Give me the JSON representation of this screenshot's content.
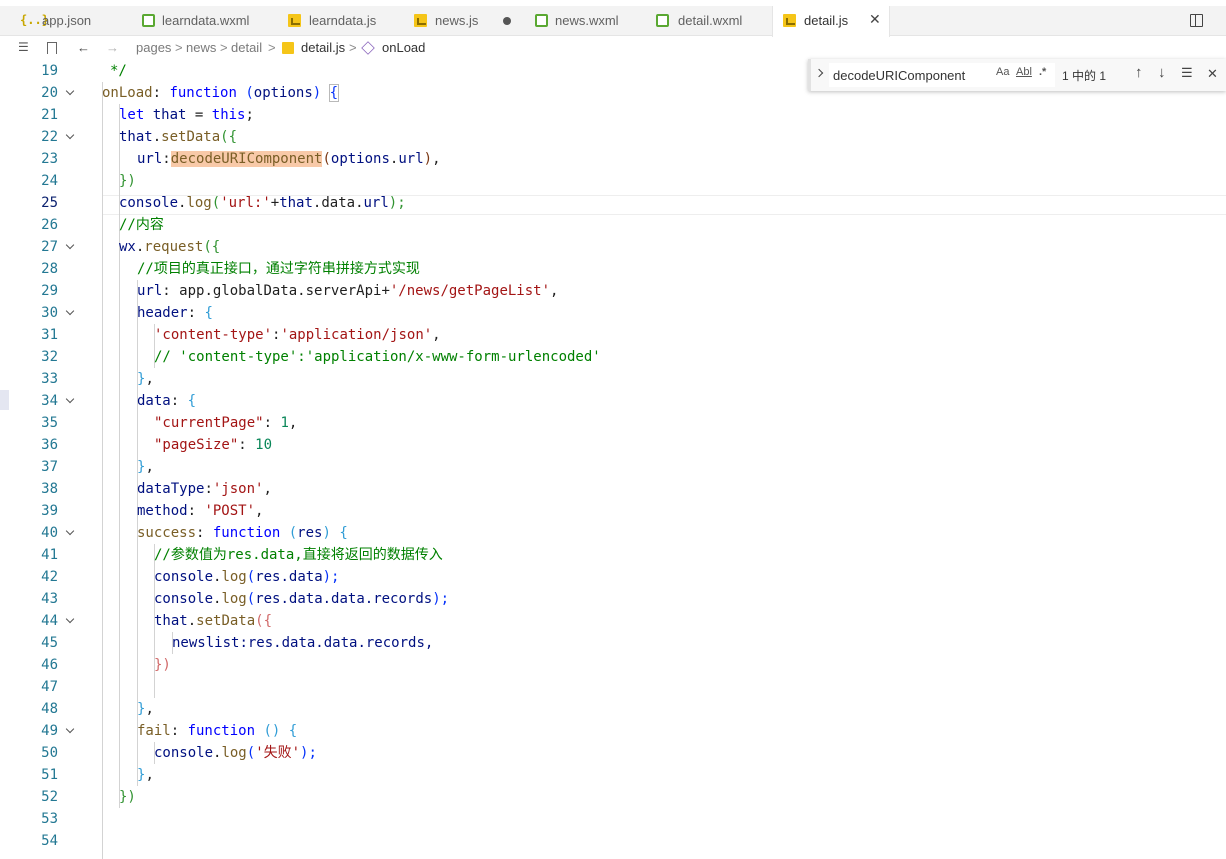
{
  "tabs": [
    {
      "label": "app.json",
      "icon": "json-file-icon"
    },
    {
      "label": "learndata.wxml",
      "icon": "wxml-file-icon"
    },
    {
      "label": "learndata.js",
      "icon": "js-file-icon"
    },
    {
      "label": "news.js",
      "icon": "js-file-icon",
      "modified": true
    },
    {
      "label": "news.wxml",
      "icon": "wxml-file-icon"
    },
    {
      "label": "detail.wxml",
      "icon": "wxml-file-icon"
    },
    {
      "label": "detail.js",
      "icon": "js-file-icon",
      "active": true
    }
  ],
  "tab_icons": {
    "json": "{..}",
    "close": "✕"
  },
  "breadcrumb": {
    "parts": [
      "pages",
      "news",
      "detail",
      "detail.js",
      "onLoad"
    ],
    "separator": ">"
  },
  "find": {
    "query": "decodeURIComponent",
    "match_case": "Aa",
    "whole_word": "Abl",
    "regex": ".*",
    "result": "1 中的 1",
    "prev": "↑",
    "next": "↓",
    "in_selection": "☰",
    "close": "✕"
  },
  "nav": {
    "back": "←",
    "forward": "→",
    "list": "☰",
    "bookmark": "🔖"
  },
  "editor": {
    "current_line": "25",
    "line_numbers": [
      "19",
      "20",
      "21",
      "22",
      "23",
      "24",
      "25",
      "26",
      "27",
      "28",
      "29",
      "30",
      "31",
      "32",
      "33",
      "34",
      "35",
      "36",
      "37",
      "38",
      "39",
      "40",
      "41",
      "42",
      "43",
      "44",
      "45",
      "46",
      "47",
      "48",
      "49",
      "50",
      "51",
      "52",
      "53",
      "54"
    ],
    "fold_lines": [
      "20",
      "22",
      "27",
      "30",
      "34",
      "40",
      "44",
      "49"
    ]
  },
  "code": {
    "l19": "*/",
    "l20": {
      "a": "onLoad",
      "b": ":",
      "c": "function",
      "d": "(",
      "e": "options",
      "f": ")",
      "g": "{"
    },
    "l21": {
      "a": "let",
      "b": "that",
      "c": "=",
      "d": "this",
      "e": ";"
    },
    "l22": {
      "a": "that",
      "b": ".",
      "c": "setData",
      "d": "({"
    },
    "l23": {
      "a": "url",
      "b": ":",
      "c": "decodeURIComponent",
      "d": "(",
      "e": "options",
      "f": ".",
      "g": "url",
      "h": ")",
      "i": ","
    },
    "l24": "})",
    "l25": {
      "a": "console",
      "b": ".",
      "c": "log",
      "d": "(",
      "e": "'url:'",
      "f": "+",
      "g": "that",
      "h": ".data.",
      "i": "url",
      "j": ");"
    },
    "l26": "//内容",
    "l27": {
      "a": "wx",
      "b": ".",
      "c": "request",
      "d": "({"
    },
    "l28": "//项目的真正接口，通过字符串拼接方式实现",
    "l29": {
      "a": "url",
      "b": ": app.globalData.serverApi+",
      "c": "'/news/getPageList'",
      "d": ","
    },
    "l30": {
      "a": "header",
      "b": ": ",
      "c": "{"
    },
    "l31": {
      "a": "'content-type'",
      "b": ":",
      "c": "'application/json'",
      "d": ","
    },
    "l32": "// 'content-type':'application/x-www-form-urlencoded'",
    "l33": {
      "a": "}",
      "b": ","
    },
    "l34": {
      "a": "data",
      "b": ": ",
      "c": "{"
    },
    "l35": {
      "a": "\"currentPage\"",
      "b": ": ",
      "c": "1",
      "d": ","
    },
    "l36": {
      "a": "\"pageSize\"",
      "b": ": ",
      "c": "10"
    },
    "l37": {
      "a": "}",
      "b": ","
    },
    "l38": {
      "a": "dataType",
      "b": ":",
      "c": "'json'",
      "d": ","
    },
    "l39": {
      "a": "method",
      "b": ": ",
      "c": "'POST'",
      "d": ","
    },
    "l40": {
      "a": "success",
      "b": ": ",
      "c": "function",
      "d": " (",
      "e": "res",
      "f": ") ",
      "g": "{"
    },
    "l41": "//参数值为res.data,直接将返回的数据传入",
    "l42": {
      "a": "console",
      "b": ".",
      "c": "log",
      "d": "(",
      "e": "res.data",
      "f": ");"
    },
    "l43": {
      "a": "console",
      "b": ".",
      "c": "log",
      "d": "(",
      "e": "res.data.data.records",
      "f": ");"
    },
    "l44": {
      "a": "that",
      "b": ".",
      "c": "setData",
      "d": "({"
    },
    "l45": {
      "a": "newslist",
      "b": ":res.data.data.records,"
    },
    "l46": "})",
    "l48": {
      "a": "}",
      "b": ","
    },
    "l49": {
      "a": "fail",
      "b": ": ",
      "c": "function",
      "d": " () ",
      "e": "{"
    },
    "l50": {
      "a": "console",
      "b": ".",
      "c": "log",
      "d": "(",
      "e": "'失败'",
      "f": ");"
    },
    "l51": {
      "a": "}",
      "b": ","
    },
    "l52": "})"
  },
  "colors": {
    "keyword": "#0000ff",
    "function": "#795e26",
    "string": "#a31515",
    "comment": "#008000",
    "number": "#098658",
    "line_number": "#237893",
    "highlight": "#f8c9a8"
  }
}
